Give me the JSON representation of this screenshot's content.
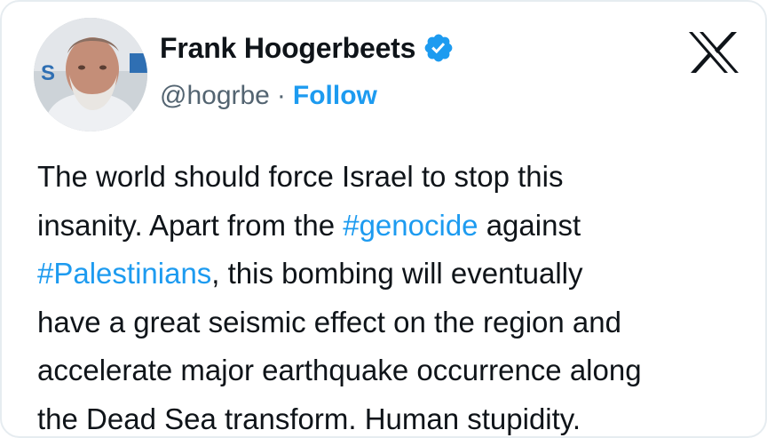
{
  "author": {
    "display_name": "Frank Hoogerbeets",
    "handle": "@hogrbe",
    "separator": "·",
    "follow_label": "Follow",
    "avatar_letters": "S"
  },
  "tweet": {
    "lines": [
      {
        "text": "The world should force Israel to stop this"
      },
      {
        "text": "insanity. Apart from the ",
        "tag": "#genocide",
        "after": " against"
      },
      {
        "tag": "#Palestinians",
        "after": ", this bombing will eventually"
      },
      {
        "text": "have a great seismic effect on the region and"
      },
      {
        "text": "accelerate major earthquake occurrence along"
      },
      {
        "text": "the Dead Sea transform. Human stupidity."
      }
    ]
  },
  "colors": {
    "accent": "#1d9bf0",
    "text": "#0f1419",
    "muted": "#536471"
  },
  "icons": {
    "verified": "verified-badge-icon",
    "platform": "x-logo-icon"
  }
}
